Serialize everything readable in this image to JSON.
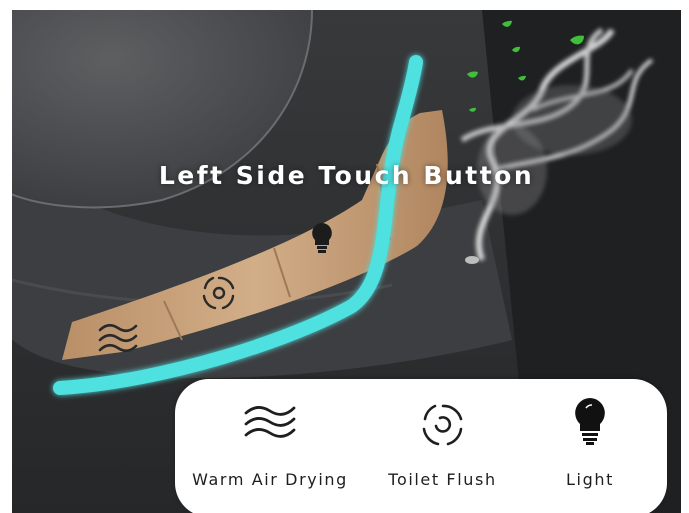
{
  "title": "Left Side Touch Button",
  "buttons": [
    {
      "label": "Warm Air Drying",
      "icon": "warm-air-drying-icon"
    },
    {
      "label": "Toilet Flush",
      "icon": "toilet-flush-icon"
    },
    {
      "label": "Light",
      "icon": "light-bulb-icon"
    }
  ],
  "colors": {
    "accent_light_strip": "#4fe0e0",
    "panel_gold": "#c9a27c",
    "seat_dark": "#2f3032",
    "leaf_green": "#3fbf3a"
  }
}
